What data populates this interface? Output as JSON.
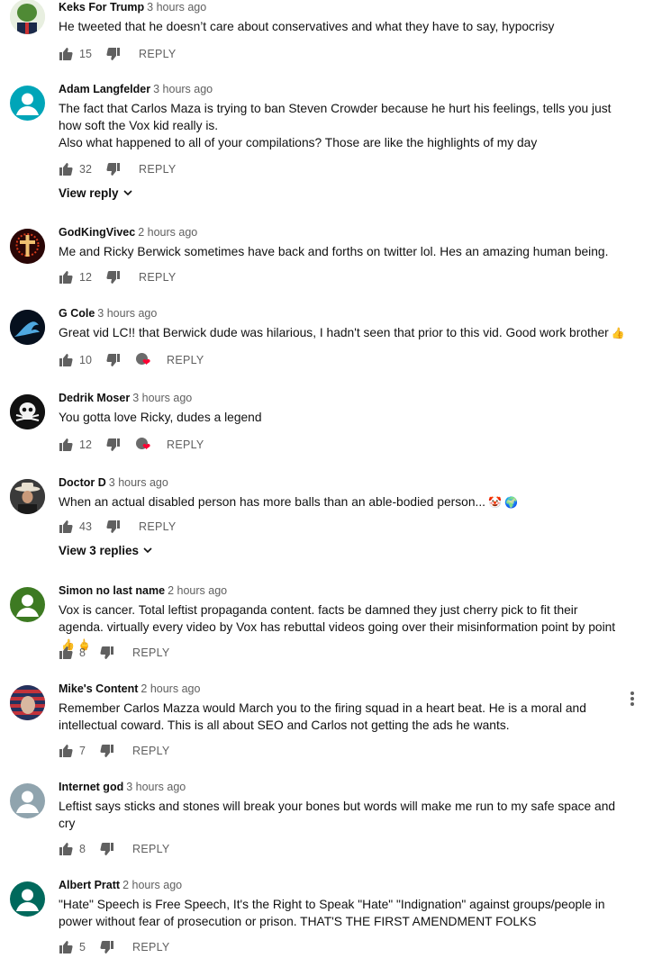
{
  "reply_label": "REPLY",
  "comments": [
    {
      "author": "Keks For Trump",
      "time": "3 hours ago",
      "lines": [
        "He tweeted that he doesn’t care about conservatives and what they have to say, hypocrisy"
      ],
      "likes": "15",
      "avatar_color": "#2f5e27",
      "avatar_icon": "pepe-avatar-icon"
    },
    {
      "author": "Adam Langfelder",
      "time": "3 hours ago",
      "lines": [
        "The fact that Carlos Maza is trying to ban Steven Crowder because he hurt his feelings, tells you just how soft the Vox kid really is.",
        "Also what happened to all of your compilations? Those are like the highlights of my day"
      ],
      "likes": "32",
      "view_replies": "View reply",
      "avatar_color": "#00a5b8"
    },
    {
      "author": "GodKingVivec",
      "time": "2 hours ago",
      "lines": [
        "Me and Ricky Berwick sometimes have back and forths on twitter lol. Hes an amazing human being."
      ],
      "likes": "12",
      "avatar_color": "#3a0a0a"
    },
    {
      "author": "G Cole",
      "time": "3 hours ago",
      "lines": [
        "Great vid LC!! that Berwick dude was hilarious, I hadn't seen that prior to this vid. Good work brother"
      ],
      "emoji": "👍",
      "likes": "10",
      "hearted": true,
      "avatar_color": "#0a1830"
    },
    {
      "author": "Dedrik Moser",
      "time": "3 hours ago",
      "lines": [
        "You gotta love Ricky, dudes a legend"
      ],
      "likes": "12",
      "hearted": true,
      "avatar_color": "#111111"
    },
    {
      "author": "Doctor D",
      "time": "3 hours ago",
      "lines": [
        "When an actual disabled person has more balls than an able-bodied person..."
      ],
      "emoji": "🤡 🌍",
      "likes": "43",
      "view_replies": "View 3 replies",
      "avatar_color": "#2a2a2a"
    },
    {
      "author": "Simon no last name",
      "time": "2 hours ago",
      "lines": [
        "Vox is cancer. Total leftist propaganda content. facts be damned they just cherry pick to fit their agenda. virtually every video by Vox has rebuttal videos going over their misinformation point by point"
      ],
      "emoji": "👍 🖕",
      "likes": "8",
      "avatar_color": "#3d7a22"
    },
    {
      "author": "Mike's Content",
      "time": "2 hours ago",
      "lines": [
        "Remember Carlos Mazza would March you to the firing squad in a heart beat. He is a moral and intellectual coward. This is all about SEO and Carlos not getting the ads he wants."
      ],
      "likes": "7",
      "avatar_color": "#8a2a2a",
      "show_more_menu": true
    },
    {
      "author": "Internet god",
      "time": "3 hours ago",
      "lines": [
        "Leftist says sticks and stones will break your bones but words will make me run to my safe space and cry"
      ],
      "likes": "8",
      "avatar_color": "#90a4ae"
    },
    {
      "author": "Albert Pratt",
      "time": "2 hours ago",
      "lines": [
        "\"Hate\" Speech is Free Speech, It's the Right to Speak \"Hate\" \"Indignation\" against groups/people in power without fear of prosecution or prison. THAT'S THE FIRST AMENDMENT FOLKS"
      ],
      "likes": "5",
      "avatar_color": "#00695c"
    }
  ]
}
